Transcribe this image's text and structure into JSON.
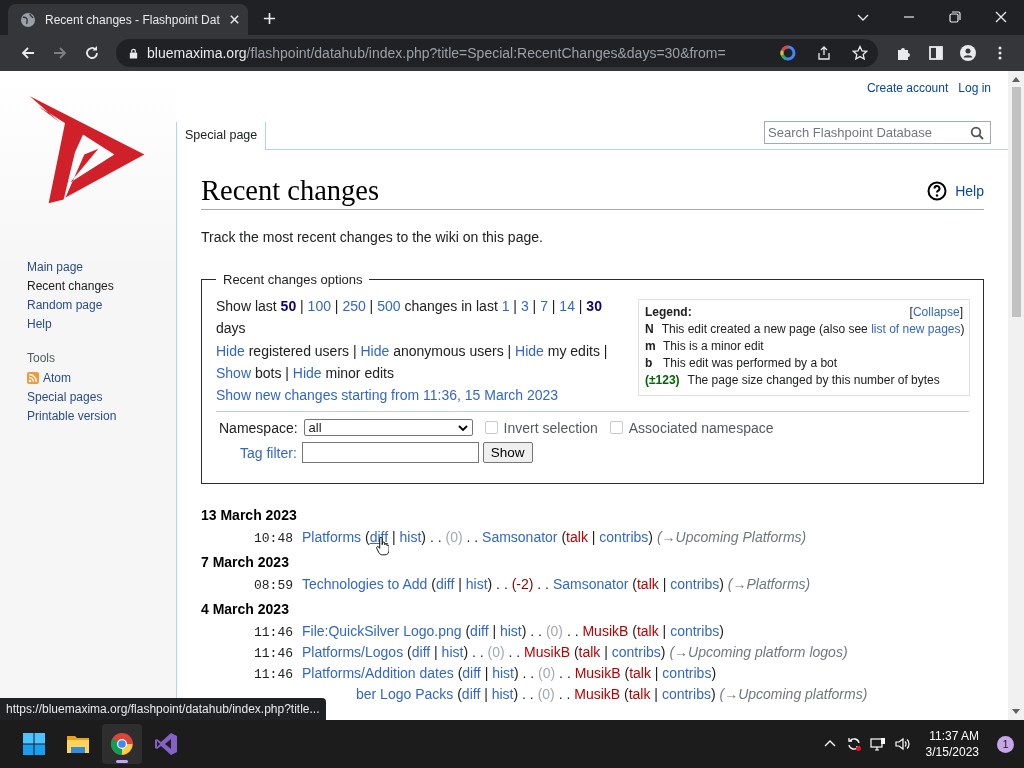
{
  "browser": {
    "tab_title": "Recent changes - Flashpoint Dat",
    "url_host": "bluemaxima.org",
    "url_path": "/flashpoint/datahub/index.php?title=Special:RecentChanges&days=30&from="
  },
  "personal": [
    "Create account",
    "Log in"
  ],
  "sidebar": {
    "nav": [
      {
        "label": "Main page",
        "visited": false
      },
      {
        "label": "Recent changes",
        "visited": true
      },
      {
        "label": "Random page",
        "visited": false
      },
      {
        "label": "Help",
        "visited": false
      }
    ],
    "tools_heading": "Tools",
    "tools": [
      {
        "label": "Atom",
        "kind": "feed"
      },
      {
        "label": "Special pages",
        "kind": "plain"
      },
      {
        "label": "Printable version",
        "kind": "plain"
      }
    ]
  },
  "page_tab": "Special page",
  "search": {
    "placeholder": "Search Flashpoint Database"
  },
  "page": {
    "title": "Recent changes",
    "help": "Help",
    "intro": "Track the most recent changes to the wiki on this page."
  },
  "options": {
    "title": "Recent changes options",
    "lines": [
      [
        {
          "text": "Show last ",
          "kind": "text"
        },
        {
          "text": "50",
          "kind": "current"
        },
        {
          "text": " | ",
          "kind": "text"
        },
        {
          "text": "100",
          "kind": "link"
        },
        {
          "text": " | ",
          "kind": "text"
        },
        {
          "text": "250",
          "kind": "link"
        },
        {
          "text": " | ",
          "kind": "text"
        },
        {
          "text": "500",
          "kind": "link"
        },
        {
          "text": " changes in last ",
          "kind": "text"
        },
        {
          "text": "1",
          "kind": "link"
        },
        {
          "text": " | ",
          "kind": "text"
        },
        {
          "text": "3",
          "kind": "link"
        },
        {
          "text": " | ",
          "kind": "text"
        },
        {
          "text": "7",
          "kind": "link"
        },
        {
          "text": " | ",
          "kind": "text"
        },
        {
          "text": "14",
          "kind": "link"
        },
        {
          "text": " | ",
          "kind": "text"
        },
        {
          "text": "30",
          "kind": "current"
        },
        {
          "text": " days",
          "kind": "text"
        }
      ],
      [
        {
          "text": "Hide",
          "kind": "link"
        },
        {
          "text": " registered users | ",
          "kind": "text"
        },
        {
          "text": "Hide",
          "kind": "link"
        },
        {
          "text": " anonymous users | ",
          "kind": "text"
        },
        {
          "text": "Hide",
          "kind": "link"
        },
        {
          "text": " my edits | ",
          "kind": "text"
        },
        {
          "text": "Show",
          "kind": "link"
        },
        {
          "text": " bots | ",
          "kind": "text"
        },
        {
          "text": "Hide",
          "kind": "link"
        },
        {
          "text": " minor edits",
          "kind": "text"
        }
      ],
      [
        {
          "text": "Show new changes starting from 11:36, 15 March 2023",
          "kind": "link"
        }
      ]
    ],
    "legend": {
      "title": "Legend:",
      "collapse": "Collapse",
      "collapse_open": "[",
      "collapse_close": "]",
      "entries": [
        {
          "key": "N",
          "parts": [
            {
              "text": "This edit created a new page (also see ",
              "kind": "text"
            },
            {
              "text": "list of new pages",
              "kind": "link"
            },
            {
              "text": ")",
              "kind": "text"
            }
          ]
        },
        {
          "key": "m",
          "parts": [
            {
              "text": "This is a minor edit",
              "kind": "text"
            }
          ]
        },
        {
          "key": "b",
          "parts": [
            {
              "text": "This edit was performed by a bot",
              "kind": "text"
            }
          ]
        },
        {
          "key": "(±123)",
          "parts": [
            {
              "text": "The page size changed by this number of bytes",
              "kind": "text"
            }
          ]
        }
      ]
    },
    "namespace_label": "Namespace:",
    "namespace_value": "all",
    "checkboxes": [
      {
        "label": "Invert selection",
        "checked": false,
        "disabled": true
      },
      {
        "label": "Associated namespace",
        "checked": false,
        "disabled": true
      }
    ],
    "tag_label": "Tag filter:",
    "show_button": "Show"
  },
  "changes": [
    {
      "date": "13 March 2023",
      "rows": [
        {
          "time": "10:48",
          "parts": [
            {
              "text": "Platforms",
              "kind": "link"
            },
            {
              "text": " (",
              "kind": "text"
            },
            {
              "text": "diff",
              "kind": "hovered"
            },
            {
              "text": " | ",
              "kind": "text"
            },
            {
              "text": "hist",
              "kind": "link"
            },
            {
              "text": ") . . ",
              "kind": "text"
            },
            {
              "text": "(0)",
              "kind": "zero"
            },
            {
              "text": " . . ",
              "kind": "text"
            },
            {
              "text": "Samsonator",
              "kind": "link"
            },
            {
              "text": " (",
              "kind": "text"
            },
            {
              "text": "talk",
              "kind": "new"
            },
            {
              "text": " | ",
              "kind": "text"
            },
            {
              "text": "contribs",
              "kind": "link"
            },
            {
              "text": ") ",
              "kind": "text"
            },
            {
              "text": "(→Upcoming Platforms)",
              "kind": "comment"
            }
          ]
        }
      ]
    },
    {
      "date": "7 March 2023",
      "rows": [
        {
          "time": "08:59",
          "parts": [
            {
              "text": "Technologies to Add",
              "kind": "link"
            },
            {
              "text": " (",
              "kind": "text"
            },
            {
              "text": "diff",
              "kind": "link"
            },
            {
              "text": " | ",
              "kind": "text"
            },
            {
              "text": "hist",
              "kind": "link"
            },
            {
              "text": ") . . ",
              "kind": "text"
            },
            {
              "text": "(-2)",
              "kind": "minus"
            },
            {
              "text": " . . ",
              "kind": "text"
            },
            {
              "text": "Samsonator",
              "kind": "link"
            },
            {
              "text": " (",
              "kind": "text"
            },
            {
              "text": "talk",
              "kind": "new"
            },
            {
              "text": " | ",
              "kind": "text"
            },
            {
              "text": "contribs",
              "kind": "link"
            },
            {
              "text": ") ",
              "kind": "text"
            },
            {
              "text": "(→Platforms)",
              "kind": "comment"
            }
          ]
        }
      ]
    },
    {
      "date": "4 March 2023",
      "rows": [
        {
          "time": "11:46",
          "parts": [
            {
              "text": "File:QuickSilver Logo.png",
              "kind": "link"
            },
            {
              "text": " (",
              "kind": "text"
            },
            {
              "text": "diff",
              "kind": "link"
            },
            {
              "text": " | ",
              "kind": "text"
            },
            {
              "text": "hist",
              "kind": "link"
            },
            {
              "text": ") . . ",
              "kind": "text"
            },
            {
              "text": "(0)",
              "kind": "zero"
            },
            {
              "text": " . . ",
              "kind": "text"
            },
            {
              "text": "MusikB",
              "kind": "new"
            },
            {
              "text": " (",
              "kind": "text"
            },
            {
              "text": "talk",
              "kind": "new"
            },
            {
              "text": " | ",
              "kind": "text"
            },
            {
              "text": "contribs",
              "kind": "link"
            },
            {
              "text": ")",
              "kind": "text"
            }
          ]
        },
        {
          "time": "11:46",
          "parts": [
            {
              "text": "Platforms/Logos",
              "kind": "link"
            },
            {
              "text": " (",
              "kind": "text"
            },
            {
              "text": "diff",
              "kind": "link"
            },
            {
              "text": " | ",
              "kind": "text"
            },
            {
              "text": "hist",
              "kind": "link"
            },
            {
              "text": ") . . ",
              "kind": "text"
            },
            {
              "text": "(0)",
              "kind": "zero"
            },
            {
              "text": " . . ",
              "kind": "text"
            },
            {
              "text": "MusikB",
              "kind": "new"
            },
            {
              "text": " (",
              "kind": "text"
            },
            {
              "text": "talk",
              "kind": "new"
            },
            {
              "text": " | ",
              "kind": "text"
            },
            {
              "text": "contribs",
              "kind": "link"
            },
            {
              "text": ") ",
              "kind": "text"
            },
            {
              "text": "(→Upcoming platform logos)",
              "kind": "comment"
            }
          ]
        },
        {
          "time": "11:46",
          "parts": [
            {
              "text": "Platforms/Addition dates",
              "kind": "link"
            },
            {
              "text": " (",
              "kind": "text"
            },
            {
              "text": "diff",
              "kind": "link"
            },
            {
              "text": " | ",
              "kind": "text"
            },
            {
              "text": "hist",
              "kind": "link"
            },
            {
              "text": ") . . ",
              "kind": "text"
            },
            {
              "text": "(0)",
              "kind": "zero"
            },
            {
              "text": " . . ",
              "kind": "text"
            },
            {
              "text": "MusikB",
              "kind": "new"
            },
            {
              "text": " (",
              "kind": "text"
            },
            {
              "text": "talk",
              "kind": "new"
            },
            {
              "text": " | ",
              "kind": "text"
            },
            {
              "text": "contribs",
              "kind": "link"
            },
            {
              "text": ")",
              "kind": "text"
            }
          ]
        },
        {
          "parts": [
            {
              "text": "ber Logo Packs",
              "kind": "link"
            },
            {
              "text": " (",
              "kind": "text"
            },
            {
              "text": "diff",
              "kind": "link"
            },
            {
              "text": " | ",
              "kind": "text"
            },
            {
              "text": "hist",
              "kind": "link"
            },
            {
              "text": ") . . ",
              "kind": "text"
            },
            {
              "text": "(0)",
              "kind": "zero"
            },
            {
              "text": " . . ",
              "kind": "text"
            },
            {
              "text": "MusikB",
              "kind": "new"
            },
            {
              "text": " (",
              "kind": "text"
            },
            {
              "text": "talk",
              "kind": "new"
            },
            {
              "text": " | ",
              "kind": "text"
            },
            {
              "text": "contribs",
              "kind": "link"
            },
            {
              "text": ") ",
              "kind": "text"
            },
            {
              "text": "(→Upcoming platforms)",
              "kind": "comment"
            }
          ]
        }
      ]
    }
  ],
  "status_url": "https://bluemaxima.org/flashpoint/datahub/index.php?title...",
  "taskbar": {
    "apps": [
      {
        "kind": "start",
        "active": false
      },
      {
        "kind": "files",
        "active": false
      },
      {
        "kind": "chrome",
        "active": true
      },
      {
        "kind": "studio",
        "active": false
      }
    ],
    "time": "11:37 AM",
    "date": "3/15/2023",
    "notifications": "1"
  }
}
